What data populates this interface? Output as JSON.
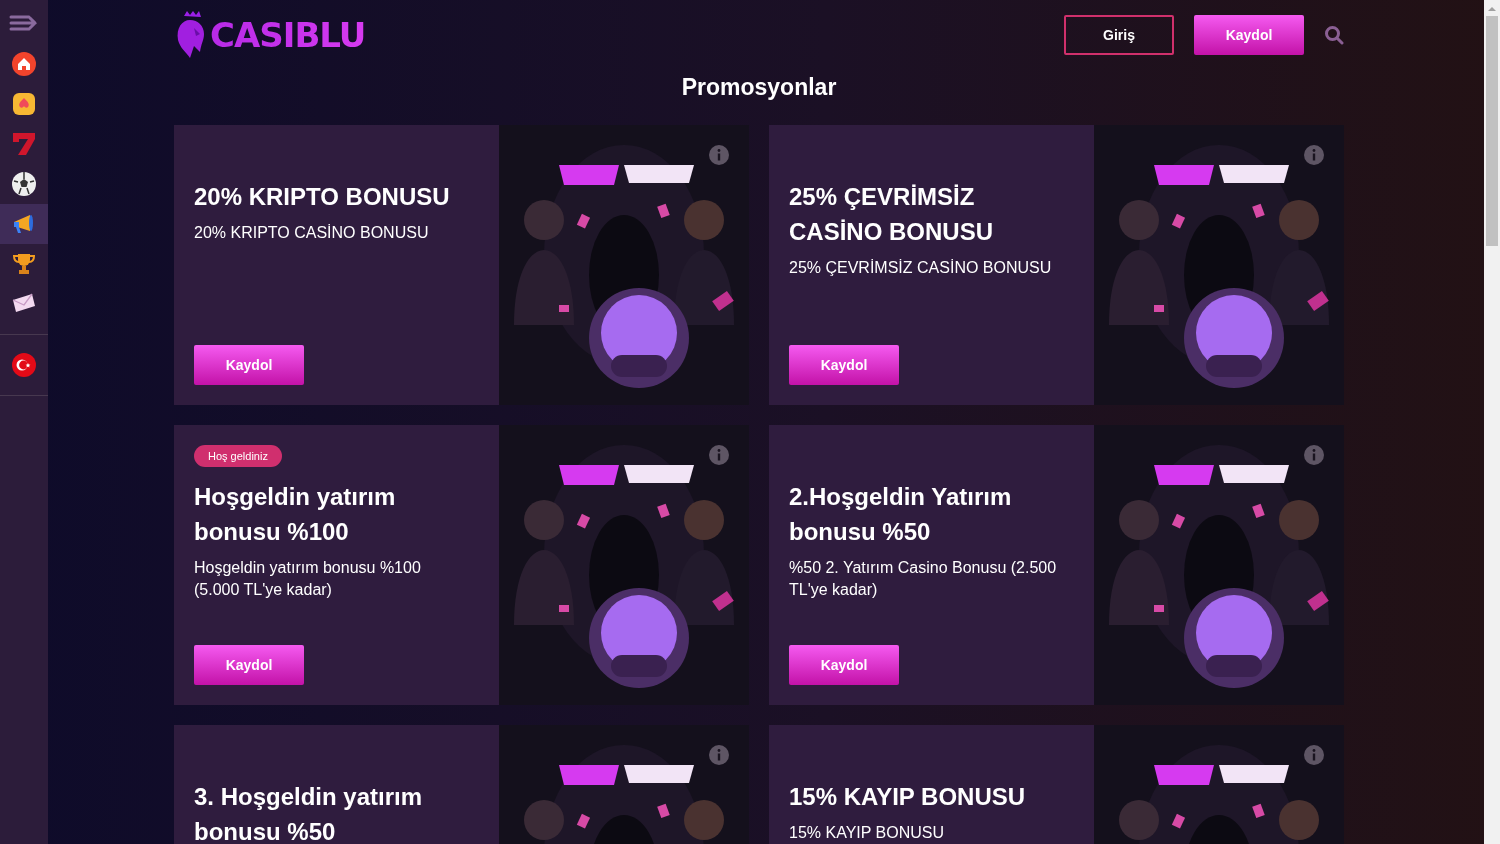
{
  "sidebar": {
    "items": [
      {
        "selected": false
      },
      {
        "selected": false
      },
      {
        "selected": false
      },
      {
        "selected": false
      },
      {
        "selected": true
      },
      {
        "selected": false
      },
      {
        "selected": false
      }
    ]
  },
  "header": {
    "logo": "CASIBLU",
    "login": "Giriş",
    "register": "Kaydol"
  },
  "page_title": "Promosyonlar",
  "promotions": [
    {
      "title": "20% KRIPTO BONUSU",
      "description": "20% KRIPTO CASİNO BONUSU",
      "button": "Kaydol"
    },
    {
      "title": "25% ÇEVRİMSİZ CASİNO BONUSU",
      "description": "25% ÇEVRİMSİZ CASİNO BONUSU",
      "button": "Kaydol"
    },
    {
      "badge": "Hoş geldiniz",
      "title": "Hoşgeldin yatırım bonusu %100",
      "description": "Hoşgeldin yatırım bonusu %100 (5.000 TL'ye kadar)",
      "button": "Kaydol"
    },
    {
      "title": "2.Hoşgeldin Yatırım bonusu %50",
      "description": "%50 2. Yatırım Casino Bonusu (2.500 TL'ye kadar)",
      "button": "Kaydol"
    },
    {
      "title": "3. Hoşgeldin yatırım bonusu %50"
    },
    {
      "title": "15% KAYIP BONUSU",
      "description": "15% KAYIP BONUSU"
    }
  ]
}
